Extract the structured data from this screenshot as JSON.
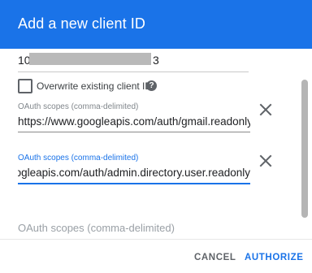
{
  "dialog": {
    "title": "Add a new client ID"
  },
  "client_id": {
    "prefix": "10",
    "suffix": "3"
  },
  "overwrite": {
    "label": "Overwrite existing client ID",
    "checked": false,
    "help_icon": "help-circle-icon"
  },
  "scopes": [
    {
      "label": "OAuth scopes (comma-delimited)",
      "value": "https://www.googleapis.com/auth/gmail.readonly"
    },
    {
      "label": "OAuth scopes (comma-delimited)",
      "value": "https://www.googleapis.com/auth/admin.directory.user.readonly"
    },
    {
      "placeholder": "OAuth scopes (comma-delimited)",
      "value": ""
    }
  ],
  "footer": {
    "cancel_label": "CANCEL",
    "authorize_label": "AUTHORIZE"
  },
  "colors": {
    "accent": "#1a73e8",
    "header_text": "#ffffff"
  }
}
